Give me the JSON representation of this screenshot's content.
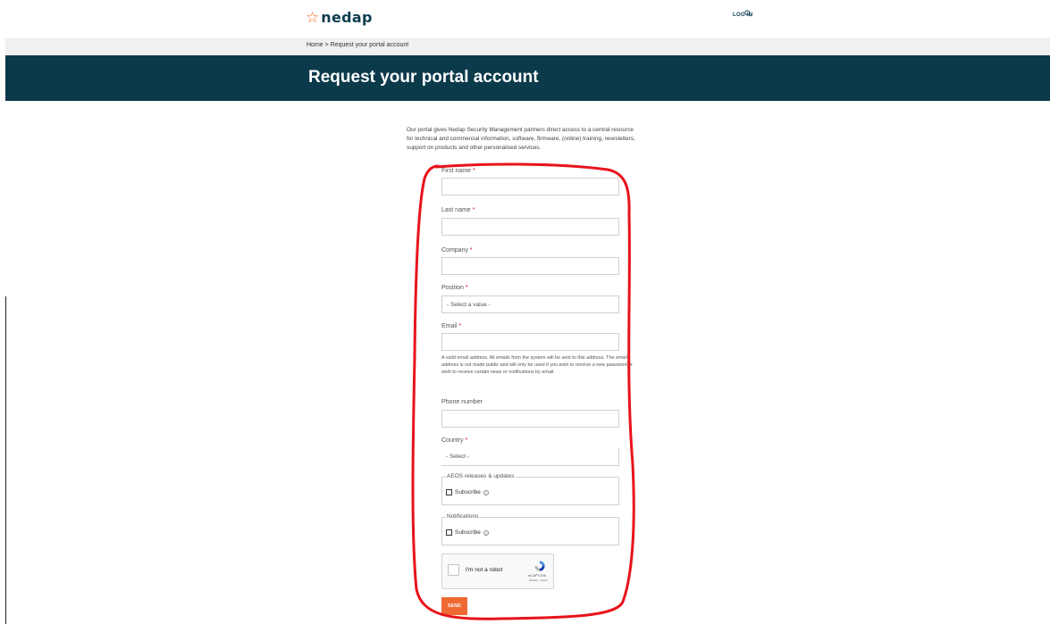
{
  "header": {
    "logo_text": "nedap",
    "logo_star": "☆",
    "login_label": "LOG IN",
    "search_icon": "search-icon"
  },
  "breadcrumb": "Home > Request your portal account",
  "page_title": "Request your portal account",
  "intro": "Our portal gives Nedap Security Management partners direct access to a central resource for technical and commercial information, software, firmware, (online) training, newsletters, support on products and other personalised services.",
  "form": {
    "first_name": {
      "label": "First name",
      "required": "*",
      "value": ""
    },
    "last_name": {
      "label": "Last name",
      "required": "*",
      "value": ""
    },
    "company": {
      "label": "Company",
      "required": "*",
      "value": ""
    },
    "position": {
      "label": "Position",
      "required": "*",
      "selected": "- Select a value -"
    },
    "email": {
      "label": "Email",
      "required": "*",
      "value": "",
      "help": "A valid email address. All emails from the system will be sent to this address. The email address is not made public and will only be used if you wish to receive a new password or wish to receive certain news or notifications by email."
    },
    "phone": {
      "label": "Phone number",
      "value": ""
    },
    "country": {
      "label": "Country",
      "required": "*",
      "selected": "- Select -"
    },
    "aeos_updates": {
      "legend": "AEOS releases & updates",
      "checkbox_label": "Subscribe",
      "checked": false
    },
    "notifications": {
      "legend": "Notifications",
      "checkbox_label": "Subscribe",
      "checked": false
    },
    "captcha": {
      "label": "I'm not a robot",
      "brand": "reCAPTCHA",
      "links": "Privacy - Terms"
    },
    "submit_label": "SEND"
  },
  "colors": {
    "brand_dark": "#0b3a4b",
    "accent": "#ef6a33",
    "annotation": "#e8131c"
  }
}
